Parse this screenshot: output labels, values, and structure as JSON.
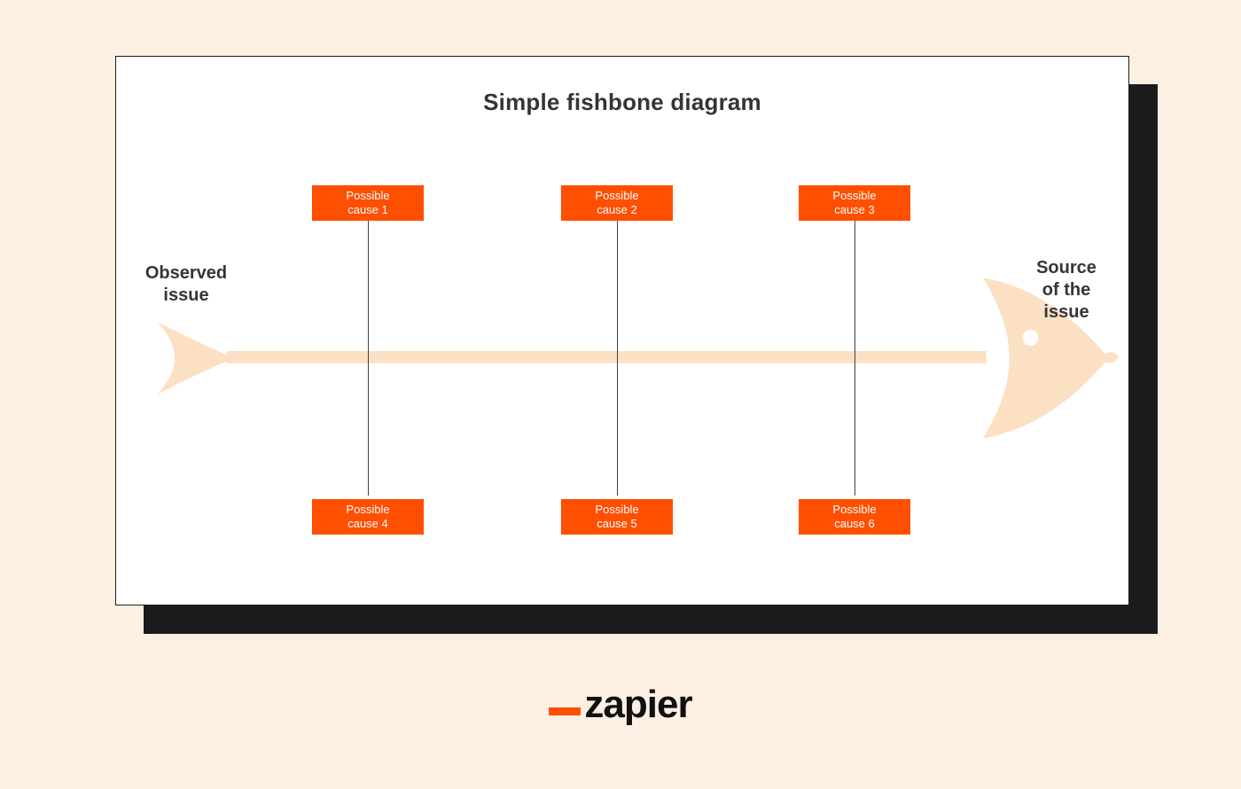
{
  "title": "Simple fishbone diagram",
  "left_label": "Observed\nissue",
  "right_label": "Source\nof the\nissue",
  "causes_top": [
    "Possible\ncause 1",
    "Possible\ncause 2",
    "Possible\ncause 3"
  ],
  "causes_bottom": [
    "Possible\ncause 4",
    "Possible\ncause 5",
    "Possible\ncause 6"
  ],
  "brand": "zapier",
  "colors": {
    "background": "#fdf0e2",
    "card_bg": "#ffffff",
    "card_border": "#1b1b1b",
    "shadow": "#1b1b1b",
    "text": "#333539",
    "cause_box": "#ff4f00",
    "cause_text": "#ffffff",
    "fish_silhouette": "#fce0c3",
    "bone_line": "#424242"
  },
  "diagram": {
    "type": "fishbone",
    "effect_head": "Source of the issue",
    "problem_tail": "Observed issue",
    "branches": [
      {
        "position": "top",
        "label": "Possible cause 1"
      },
      {
        "position": "top",
        "label": "Possible cause 2"
      },
      {
        "position": "top",
        "label": "Possible cause 3"
      },
      {
        "position": "bottom",
        "label": "Possible cause 4"
      },
      {
        "position": "bottom",
        "label": "Possible cause 5"
      },
      {
        "position": "bottom",
        "label": "Possible cause 6"
      }
    ]
  }
}
